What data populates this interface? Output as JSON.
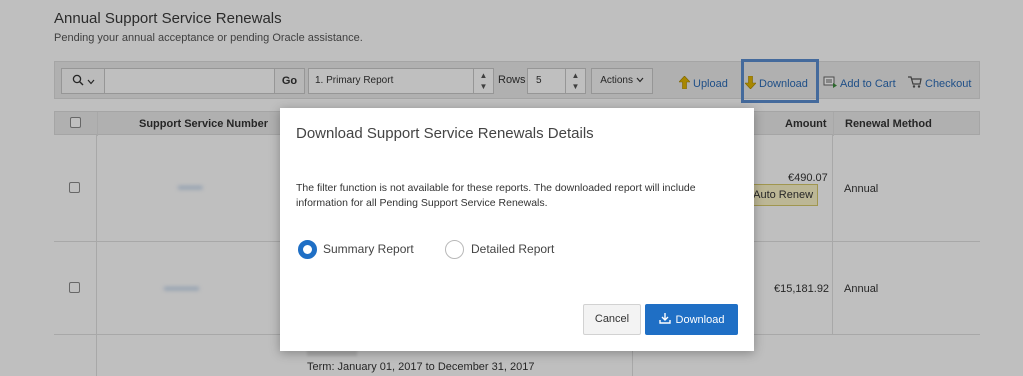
{
  "page": {
    "title": "Annual Support Service Renewals",
    "subtitle": "Pending your annual acceptance or pending Oracle assistance."
  },
  "toolbar": {
    "search_icon": "search-icon",
    "go_label": "Go",
    "report_select_value": "1. Primary Report",
    "rows_label": "Rows",
    "rows_value": "5",
    "actions_label": "Actions",
    "upload_label": "Upload",
    "download_label": "Download",
    "add_to_cart_label": "Add to Cart",
    "checkout_label": "Checkout"
  },
  "table": {
    "headers": {
      "support_service_number": "Support Service Number",
      "amount": "Amount",
      "renewal_method": "Renewal Method"
    },
    "rows": [
      {
        "amount": "€490.07",
        "auto_renew_label": "r Auto Renew",
        "renewal_method": "Annual"
      },
      {
        "amount": "€15,181.92",
        "renewal_method": "Annual"
      }
    ],
    "term_text": "Term: January 01, 2017 to December 31, 2017"
  },
  "modal": {
    "title": "Download Support Service Renewals Details",
    "message": "The filter function is not available for these reports. The downloaded report will include information for all Pending Support Service Renewals.",
    "options": [
      {
        "label": "Summary Report",
        "checked": true
      },
      {
        "label": "Detailed Report",
        "checked": false
      }
    ],
    "cancel_label": "Cancel",
    "download_label": "Download"
  },
  "colors": {
    "accent": "#1f6fc5",
    "link": "#2a6ab5",
    "focus_border": "#5b8ed1",
    "overlay": "rgba(0,0,0,0.25)"
  }
}
